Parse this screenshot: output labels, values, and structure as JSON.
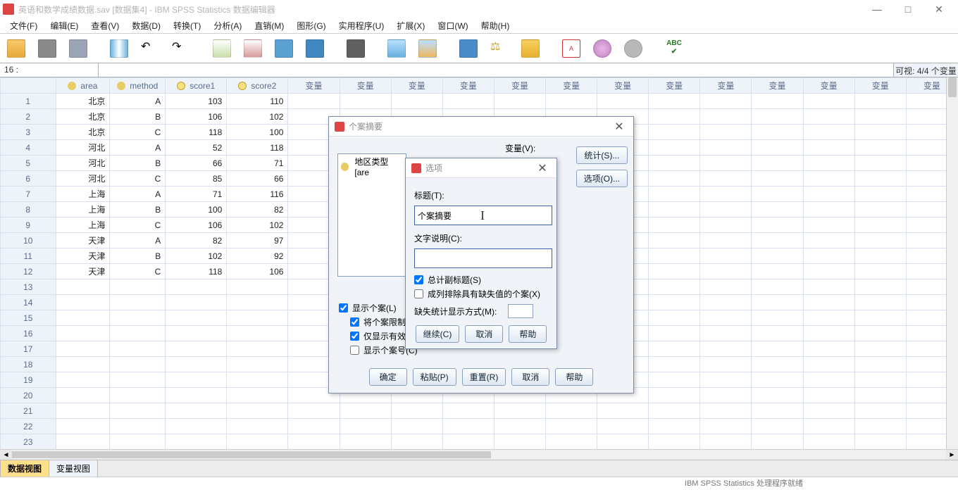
{
  "window": {
    "title": "英语和数学成绩数据.sav [数据集4] - IBM SPSS Statistics 数据编辑器",
    "min": "—",
    "max": "□",
    "close": "✕"
  },
  "menu": [
    "文件(F)",
    "编辑(E)",
    "查看(V)",
    "数据(D)",
    "转换(T)",
    "分析(A)",
    "直销(M)",
    "图形(G)",
    "实用程序(U)",
    "扩展(X)",
    "窗口(W)",
    "帮助(H)"
  ],
  "cellref": "16 :",
  "visible_count": "可视:  4/4 个变量",
  "columns": [
    "area",
    "method",
    "score1",
    "score2"
  ],
  "empty_col_label": "变量",
  "rows": [
    {
      "n": 1,
      "area": "北京",
      "method": "A",
      "score1": "103",
      "score2": "110"
    },
    {
      "n": 2,
      "area": "北京",
      "method": "B",
      "score1": "106",
      "score2": "102"
    },
    {
      "n": 3,
      "area": "北京",
      "method": "C",
      "score1": "118",
      "score2": "100"
    },
    {
      "n": 4,
      "area": "河北",
      "method": "A",
      "score1": "52",
      "score2": "118"
    },
    {
      "n": 5,
      "area": "河北",
      "method": "B",
      "score1": "66",
      "score2": "71"
    },
    {
      "n": 6,
      "area": "河北",
      "method": "C",
      "score1": "85",
      "score2": "66"
    },
    {
      "n": 7,
      "area": "上海",
      "method": "A",
      "score1": "71",
      "score2": "116"
    },
    {
      "n": 8,
      "area": "上海",
      "method": "B",
      "score1": "100",
      "score2": "82"
    },
    {
      "n": 9,
      "area": "上海",
      "method": "C",
      "score1": "106",
      "score2": "102"
    },
    {
      "n": 10,
      "area": "天津",
      "method": "A",
      "score1": "82",
      "score2": "97"
    },
    {
      "n": 11,
      "area": "天津",
      "method": "B",
      "score1": "102",
      "score2": "92"
    },
    {
      "n": 12,
      "area": "天津",
      "method": "C",
      "score1": "118",
      "score2": "106"
    }
  ],
  "blank_row_count": 11,
  "bottom_tabs": {
    "data": "数据视图",
    "var": "变量视图"
  },
  "status_proc": "IBM SPSS Statistics 处理程序就绪",
  "dlg_summary": {
    "title": "个案摘要",
    "vars_label": "变量(V):",
    "left_item": "地区类型 [are",
    "side_stats": "统计(S)...",
    "side_opts": "选项(O)...",
    "chk_show_cases": "显示个案(L)",
    "chk_limit": "将个案限制",
    "chk_valid_only": "仅显示有效",
    "chk_case_num": "显示个案号(C)",
    "btn_ok": "确定",
    "btn_paste": "粘贴(P)",
    "btn_reset": "重置(R)",
    "btn_cancel": "取消",
    "btn_help": "帮助"
  },
  "dlg_options": {
    "title": "选项",
    "lbl_title": "标题(T):",
    "val_title": "个案摘要",
    "lbl_caption": "文字说明(C):",
    "val_caption": "",
    "chk_subtotal": "总计副标题(S)",
    "chk_exclude": "成列排除具有缺失值的个案(X)",
    "lbl_missing": "缺失统计显示方式(M):",
    "btn_continue": "继续(C)",
    "btn_cancel": "取消",
    "btn_help": "帮助"
  }
}
